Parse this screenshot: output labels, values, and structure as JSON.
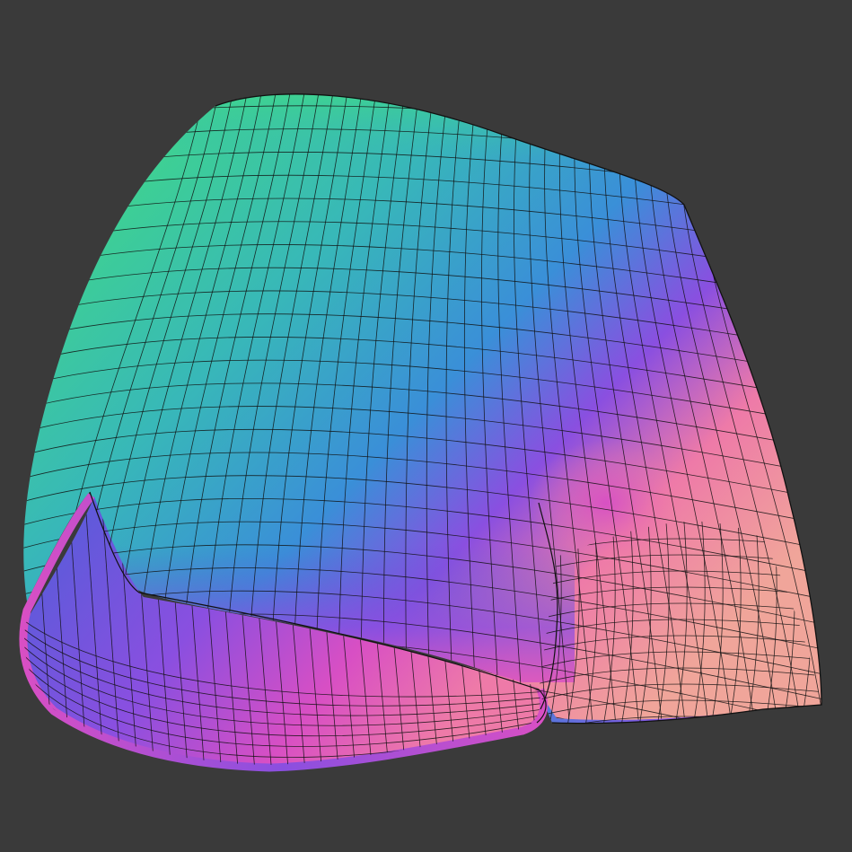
{
  "viewport": {
    "background": "#3a3a3a",
    "wire_color": "#111111"
  },
  "mesh": {
    "subject": "shorts",
    "shading": "normal-map",
    "palette": {
      "green": "#3fd58c",
      "teal": "#38b8b8",
      "blue": "#3a8fd8",
      "indigo": "#4f5ed8",
      "violet": "#8a4fe0",
      "magenta": "#d84fc4",
      "pink": "#ee7aa8",
      "peach": "#f0a59a"
    }
  }
}
